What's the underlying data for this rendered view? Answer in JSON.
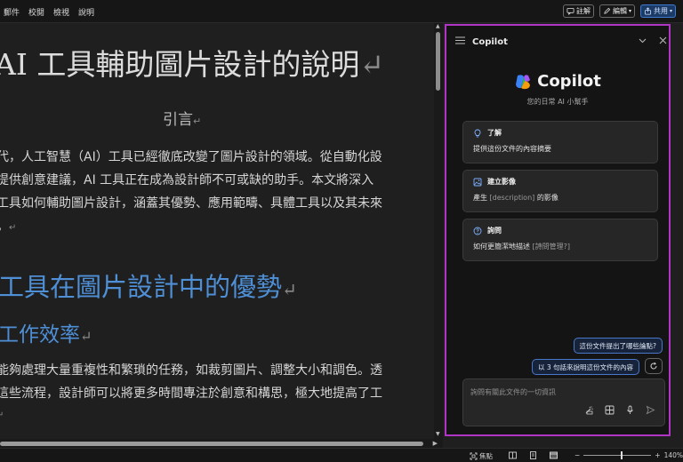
{
  "menubar": {
    "items": [
      "郵件",
      "校閱",
      "檢視",
      "說明"
    ]
  },
  "top_actions": {
    "comment": "註解",
    "editing": "編輯",
    "share": "共用"
  },
  "document": {
    "title": "AI 工具輔助圖片設計的說明",
    "subtitle": "引言",
    "para1_line1": "代，人工智慧（AI）工具已經徹底改變了圖片設計的領域。從自動化設",
    "para1_line2": "提供創意建議，AI 工具正在成為設計師不可或缺的助手。本文將深入",
    "para1_line3": "工具如何輔助圖片設計，涵蓋其優勢、應用範疇、具體工具以及其未來",
    "para1_line4": "。",
    "heading1": "工具在圖片設計中的優勢",
    "heading2": "工作效率",
    "para2_line1": "能夠處理大量重複性和繁瑣的任務，如裁剪圖片、調整大小和調色。透",
    "para2_line2": "這些流程，設計師可以將更多時間專注於創意和構思，極大地提高了工",
    "para_mark": "↵"
  },
  "copilot": {
    "header_title": "Copilot",
    "brand": "Copilot",
    "tagline": "您的日常 AI 小幫手",
    "cards": [
      {
        "title": "了解",
        "desc": "提供這份文件的內容摘要",
        "icon": "lightbulb-icon"
      },
      {
        "title": "建立影像",
        "desc_main": "產生",
        "desc_ph": "[description]",
        "desc_end": "的影像",
        "icon": "image-icon"
      },
      {
        "title": "詢問",
        "desc_main": "如何更簡潔地描述",
        "desc_ph": "[詩問管理?]",
        "icon": "question-icon"
      }
    ],
    "suggestions": [
      "這份文件提出了哪些論點?",
      "以 3 句話來說明這份文件的內容"
    ],
    "input_placeholder": "詢問有關此文件的一切資訊"
  },
  "statusbar": {
    "focus": "焦點",
    "zoom": "140%",
    "zoom_fraction": 0.55
  },
  "colors": {
    "accent_border": "#b035c4",
    "heading": "#4e8fd6",
    "chip_border": "#4a78c9"
  }
}
